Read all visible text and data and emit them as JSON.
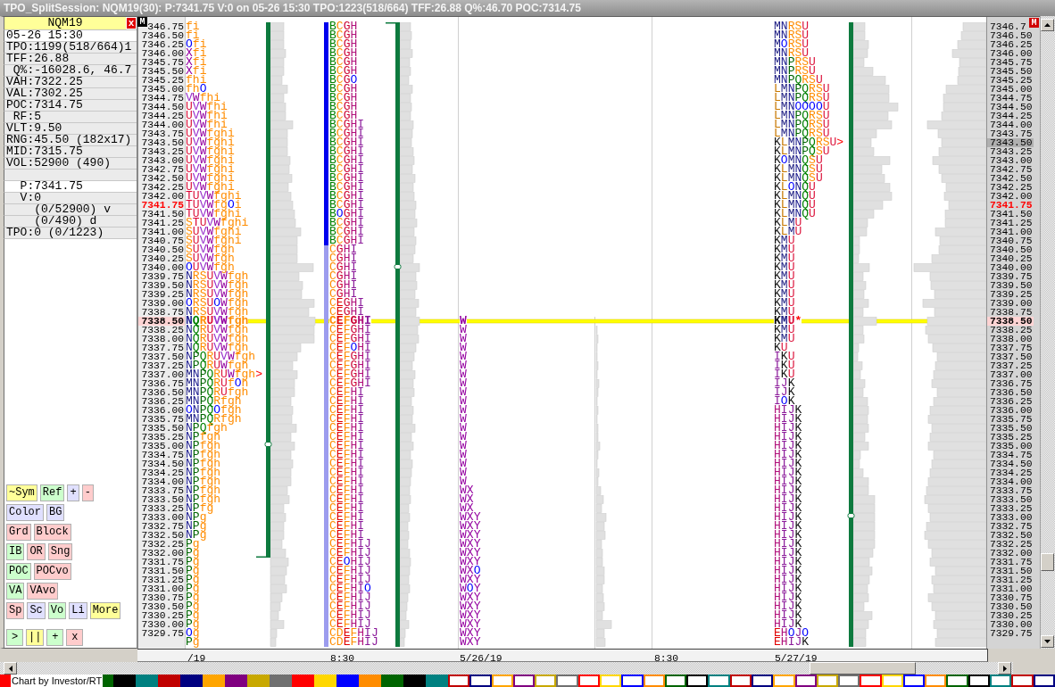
{
  "window": {
    "title": "TPO_SplitSession: NQM19(30): P:7341.75 V:0 on 05-26 15:30 TPO:1223(518/664) TFF:26.88 Q%:46.70 POC:7314.75"
  },
  "info_panel": {
    "symbol": "NQM19",
    "close": "x",
    "lines": [
      {
        "text": "05-26 15:30",
        "kind": "highlight"
      },
      {
        "text": "TPO:1199(518/664)1",
        "kind": "plain"
      },
      {
        "text": "TFF:26.88",
        "kind": "plain"
      },
      {
        "text": " Q%:-16028.6, 46.7",
        "kind": "plain"
      },
      {
        "text": "VAH:7322.25",
        "kind": "plain"
      },
      {
        "text": "VAL:7302.25",
        "kind": "plain"
      },
      {
        "text": "POC:7314.75",
        "kind": "plain"
      },
      {
        "text": " RF:5",
        "kind": "plain"
      },
      {
        "text": "VLT:9.50",
        "kind": "plain"
      },
      {
        "text": "RNG:45.50 (182x17)",
        "kind": "plain"
      },
      {
        "text": "MID:7315.75",
        "kind": "plain"
      },
      {
        "text": "VOL:52900 (490)",
        "kind": "plain"
      },
      {
        "kind": "plain"
      },
      {
        "text": "  P:7341.75",
        "kind": "highlight"
      },
      {
        "text": "  V:0",
        "kind": "plain"
      },
      {
        "text": "    (0/52900) v",
        "kind": "plain"
      },
      {
        "text": "    (0/490) d",
        "kind": "plain"
      },
      {
        "text": "TPO:0 (0/1223)",
        "kind": "plain"
      }
    ]
  },
  "button_rows": [
    {
      "buttons": [
        {
          "label": "~Sym",
          "color": "#ffff99"
        },
        {
          "label": "Ref",
          "color": "#ccffcc"
        },
        {
          "label": "+",
          "color": "#e0e0ff"
        },
        {
          "label": "-",
          "color": "#ffcccc"
        }
      ]
    },
    {
      "buttons": [
        {
          "label": "Color",
          "color": "#e0e0ff"
        },
        {
          "label": "BG",
          "color": "#e0e0ff"
        }
      ]
    },
    {
      "buttons": [
        {
          "label": "Grd",
          "color": "#ffcccc"
        },
        {
          "label": "Block",
          "color": "#ffcccc"
        }
      ]
    },
    {
      "buttons": [
        {
          "label": "IB",
          "color": "#ccffcc"
        },
        {
          "label": "OR",
          "color": "#ffcccc"
        },
        {
          "label": "Sng",
          "color": "#ffcccc"
        }
      ]
    },
    {
      "buttons": [
        {
          "label": "POC",
          "color": "#ccffcc"
        },
        {
          "label": "POCvo",
          "color": "#ffcccc"
        }
      ]
    },
    {
      "buttons": [
        {
          "label": "VA",
          "color": "#ccffcc"
        },
        {
          "label": "VAvo",
          "color": "#ffcccc"
        }
      ]
    },
    {
      "buttons": [
        {
          "label": "Sp",
          "color": "#ffcccc"
        },
        {
          "label": "Sc",
          "color": "#e0e0ff"
        },
        {
          "label": "Vo",
          "color": "#ccffcc"
        },
        {
          "label": "Li",
          "color": "#e0e0ff"
        },
        {
          "label": "More",
          "color": "#ffff99"
        }
      ]
    }
  ],
  "transport_buttons": [
    {
      "label": ">",
      "color": "#ccffcc"
    },
    {
      "label": "||",
      "color": "#ffff99"
    },
    {
      "label": "+",
      "color": "#ccffcc"
    },
    {
      "label": "x",
      "color": "#ffcccc"
    }
  ],
  "chart": {
    "menu_left": "M",
    "menu_right": "M",
    "rows": [
      {
        "price": "346.75",
        "profile_1": "fi",
        "profile_2": "BCGH",
        "profile_4": "MNRSU",
        "scale_price": "7346.7",
        "kind": "plain"
      },
      {
        "price": "7346.50",
        "profile_1": "fi",
        "profile_2": "BCGH",
        "profile_4": "MNRSU",
        "scale_price": "7346.50",
        "kind": "plain"
      },
      {
        "price": "7346.25",
        "profile_1": "Ofi",
        "profile_2": "BCGH",
        "profile_4": "MORSU",
        "scale_price": "7346.25",
        "kind": "plain"
      },
      {
        "price": "7346.00",
        "profile_1": "Xfi",
        "profile_2": "BCGH",
        "profile_4": "MNRSU",
        "scale_price": "7346.00",
        "kind": "plain"
      },
      {
        "price": "7345.75",
        "profile_1": "Xfi",
        "profile_2": "BCGH",
        "profile_4": "MNPRSU",
        "scale_price": "7345.75",
        "kind": "plain"
      },
      {
        "price": "7345.50",
        "profile_1": "Xfi",
        "profile_2": "BCGH",
        "profile_4": "MNPRSU",
        "scale_price": "7345.50",
        "kind": "plain"
      },
      {
        "price": "7345.25",
        "profile_1": "fhi",
        "profile_2": "BCGO",
        "profile_4": "MNPQRSU",
        "scale_price": "7345.25",
        "kind": "plain"
      },
      {
        "price": "7345.00",
        "profile_1": "fhO",
        "profile_2": "BCGH",
        "profile_4": "LMNPQRSU",
        "scale_price": "7345.00",
        "kind": "plain"
      },
      {
        "price": "7344.75",
        "profile_1": "VWfhi",
        "profile_2": "BCGH",
        "profile_4": "LMNPQRSU",
        "scale_price": "7344.75",
        "kind": "plain"
      },
      {
        "price": "7344.50",
        "profile_1": "UVWfhi",
        "profile_2": "BCGH",
        "profile_4": "LMNOOOOU",
        "scale_price": "7344.50",
        "kind": "plain"
      },
      {
        "price": "7344.25",
        "profile_1": "UVWfhi",
        "profile_2": "BCGH",
        "profile_4": "LMNPQRSU",
        "scale_price": "7344.25",
        "kind": "plain"
      },
      {
        "price": "7344.00",
        "profile_1": "UVWfhi",
        "profile_2": "BCGHI",
        "profile_4": "LMNPQRSU",
        "scale_price": "7344.00",
        "kind": "plain"
      },
      {
        "price": "7343.75",
        "profile_1": "UVWfghi",
        "profile_2": "BCGHI",
        "profile_4": "LMNPQRSU",
        "scale_price": "7343.75",
        "kind": "plain"
      },
      {
        "price": "7343.50",
        "profile_1": "UVWfghi",
        "profile_2": "BCGHI",
        "profile_4": "KLMNPQRSU>",
        "scale_price": "7343.50",
        "kind": "hover"
      },
      {
        "price": "7343.25",
        "profile_1": "UVWfghi",
        "profile_2": "BCGHI",
        "profile_4": "KLMNPQSU",
        "scale_price": "7343.25",
        "kind": "plain"
      },
      {
        "price": "7343.00",
        "profile_1": "UVWfghi",
        "profile_2": "BCGHI",
        "profile_4": "KOMNQSU",
        "scale_price": "7343.00",
        "kind": "plain"
      },
      {
        "price": "7342.75",
        "profile_1": "UVWfghi",
        "profile_2": "BCGHI",
        "profile_4": "KLMNQSU",
        "scale_price": "7342.75",
        "kind": "plain"
      },
      {
        "price": "7342.50",
        "profile_1": "UVWfghi",
        "profile_2": "BCGHI",
        "profile_4": "KLMNQSU",
        "scale_price": "7342.50",
        "kind": "plain"
      },
      {
        "price": "7342.25",
        "profile_1": "UVWfghi",
        "profile_2": "BCGHI",
        "profile_4": "KLONQU",
        "scale_price": "7342.25",
        "kind": "plain"
      },
      {
        "price": "7342.00",
        "profile_1": "TUVWfghi",
        "profile_2": "BCGHI",
        "profile_4": "KLMNQU",
        "scale_price": "7342.00",
        "kind": "plain"
      },
      {
        "price": "7341.75",
        "profile_1": "TUVWfgOi",
        "profile_2": "BCGHI",
        "profile_4": "KLMNQU",
        "scale_price": "7341.75",
        "kind": "last"
      },
      {
        "price": "7341.50",
        "profile_1": "TUVWfghi",
        "profile_2": "BOGHI",
        "profile_4": "KLMNQU",
        "scale_price": "7341.50",
        "kind": "plain"
      },
      {
        "price": "7341.25",
        "profile_1": "STUVWfghi",
        "profile_2": "BCGHI",
        "profile_4": "KLMU",
        "scale_price": "7341.25",
        "kind": "plain"
      },
      {
        "price": "7341.00",
        "profile_1": "SUVWfghi",
        "profile_2": "BCGHI",
        "profile_4": "KLMU",
        "scale_price": "7341.00",
        "kind": "plain"
      },
      {
        "price": "7340.75",
        "profile_1": "SUVWfghi",
        "profile_2": "BCGHI",
        "profile_4": "KMU",
        "scale_price": "7340.75",
        "kind": "plain"
      },
      {
        "price": "7340.50",
        "profile_1": "SUVWfgh",
        "profile_2": "CGHI",
        "profile_4": "KMU",
        "scale_price": "7340.50",
        "kind": "plain"
      },
      {
        "price": "7340.25",
        "profile_1": "SUVWfgh",
        "profile_2": "CGHI",
        "profile_4": "KMU",
        "scale_price": "7340.25",
        "kind": "plain"
      },
      {
        "price": "7340.00",
        "profile_1": "OUVWfgh",
        "profile_2": "CGHI",
        "profile_4": "KMU",
        "scale_price": "7340.00",
        "kind": "plain"
      },
      {
        "price": "7339.75",
        "profile_1": "NRSUVWfgh",
        "profile_2": "CGHI",
        "profile_4": "KMU",
        "scale_price": "7339.75",
        "kind": "plain"
      },
      {
        "price": "7339.50",
        "profile_1": "NRSUVWfgh",
        "profile_2": "CGHI",
        "profile_4": "KMU",
        "scale_price": "7339.50",
        "kind": "plain"
      },
      {
        "price": "7339.25",
        "profile_1": "NRSUVWfgh",
        "profile_2": "CGHI",
        "profile_4": "KMU",
        "scale_price": "7339.25",
        "kind": "plain"
      },
      {
        "price": "7339.00",
        "profile_1": "ORSUOWfgh",
        "profile_2": "CEGHI",
        "profile_4": "KMU",
        "scale_price": "7339.00",
        "kind": "plain"
      },
      {
        "price": "7338.75",
        "profile_1": "NRSUVWfgh",
        "profile_2": "CEGHI",
        "profile_4": "KMU",
        "scale_price": "7338.75",
        "kind": "plain"
      },
      {
        "price": "7338.50",
        "profile_1": "NQRUVWfgh",
        "profile_2": "CEFGHI",
        "profile_3": "W",
        "profile_4": "KMU*",
        "scale_price": "7338.50",
        "kind": "reference"
      },
      {
        "price": "7338.25",
        "profile_1": "NQRUVWfgh",
        "profile_2": "CEFGHI",
        "profile_3": "W",
        "profile_4": "KMU",
        "scale_price": "7338.25",
        "kind": "plain"
      },
      {
        "price": "7338.00",
        "profile_1": "NQRUVWfgh",
        "profile_2": "CEFGHI",
        "profile_3": "W",
        "profile_4": "KMU",
        "scale_price": "7338.00",
        "kind": "plain"
      },
      {
        "price": "7337.75",
        "profile_1": "NQRUVWfgh",
        "profile_2": "CEFOHI",
        "profile_3": "W",
        "profile_4": "KU",
        "scale_price": "7337.75",
        "kind": "plain"
      },
      {
        "price": "7337.50",
        "profile_1": "NPQRUVWfgh",
        "profile_2": "CEFGHI",
        "profile_3": "W",
        "profile_4": "IKU",
        "scale_price": "7337.50",
        "kind": "plain"
      },
      {
        "price": "7337.25",
        "profile_1": "NPQRUWfgh",
        "profile_2": "CEFGHI",
        "profile_3": "W",
        "profile_4": "IKU",
        "scale_price": "7337.25",
        "kind": "plain"
      },
      {
        "price": "7337.00",
        "profile_1": "MNPQRUWfgh>",
        "profile_2": "CEFGHI",
        "profile_3": "W",
        "profile_4": "IKU",
        "scale_price": "7337.00",
        "kind": "plain"
      },
      {
        "price": "7336.75",
        "profile_1": "MNPQRUfOh",
        "profile_2": "CEFGHI",
        "profile_3": "W",
        "profile_4": "IJK",
        "scale_price": "7336.75",
        "kind": "plain"
      },
      {
        "price": "7336.50",
        "profile_1": "MNPQRUfgh",
        "profile_2": "CEFHI",
        "profile_3": "W",
        "profile_4": "IJK",
        "scale_price": "7336.50",
        "kind": "plain"
      },
      {
        "price": "7336.25",
        "profile_1": "MNPQRfgh",
        "profile_2": "CEFHI",
        "profile_3": "W",
        "profile_4": "IOK",
        "scale_price": "7336.25",
        "kind": "plain"
      },
      {
        "price": "7336.00",
        "profile_1": "ONPQOfgh",
        "profile_2": "CEFHI",
        "profile_3": "W",
        "profile_4": "HIJK",
        "scale_price": "7336.00",
        "kind": "plain"
      },
      {
        "price": "7335.75",
        "profile_1": "MNPQRfgh",
        "profile_2": "CEFHI",
        "profile_3": "W",
        "profile_4": "HIJK",
        "scale_price": "7335.75",
        "kind": "plain"
      },
      {
        "price": "7335.50",
        "profile_1": "NPQfgh",
        "profile_2": "CEFHI",
        "profile_3": "W",
        "profile_4": "HIJK",
        "scale_price": "7335.50",
        "kind": "plain"
      },
      {
        "price": "7335.25",
        "profile_1": "NPfgh",
        "profile_2": "CEFHI",
        "profile_3": "W",
        "profile_4": "HIJK",
        "scale_price": "7335.25",
        "kind": "plain"
      },
      {
        "price": "7335.00",
        "profile_1": "NPfgh",
        "profile_2": "CEFHI",
        "profile_3": "W",
        "profile_4": "HIJK",
        "scale_price": "7335.00",
        "kind": "plain"
      },
      {
        "price": "7334.75",
        "profile_1": "NPfgh",
        "profile_2": "CEFHI",
        "profile_3": "W",
        "profile_4": "HIJK",
        "scale_price": "7334.75",
        "kind": "plain"
      },
      {
        "price": "7334.50",
        "profile_1": "NPfgh",
        "profile_2": "CEFHI",
        "profile_3": "W",
        "profile_4": "HIJK",
        "scale_price": "7334.50",
        "kind": "plain"
      },
      {
        "price": "7334.25",
        "profile_1": "NPfgh",
        "profile_2": "CEFHI",
        "profile_3": "W",
        "profile_4": "HIJK",
        "scale_price": "7334.25",
        "kind": "plain"
      },
      {
        "price": "7334.00",
        "profile_1": "NPfgh",
        "profile_2": "CEFHI",
        "profile_3": "W",
        "profile_4": "HIJK",
        "scale_price": "7334.00",
        "kind": "plain"
      },
      {
        "price": "7333.75",
        "profile_1": "NPfgh",
        "profile_2": "CEFHI",
        "profile_3": "WX",
        "profile_4": "HIJK",
        "scale_price": "7333.75",
        "kind": "plain"
      },
      {
        "price": "7333.50",
        "profile_1": "NPfgh",
        "profile_2": "CEFHI",
        "profile_3": "WX",
        "profile_4": "HIJK",
        "scale_price": "7333.50",
        "kind": "plain"
      },
      {
        "price": "7333.25",
        "profile_1": "NPfg",
        "profile_2": "CEFHI",
        "profile_3": "WX",
        "profile_4": "HIJK",
        "scale_price": "7333.25",
        "kind": "plain"
      },
      {
        "price": "7333.00",
        "profile_1": "NPg",
        "profile_2": "CEFHI",
        "profile_3": "WXY",
        "profile_4": "HIJK",
        "scale_price": "7333.00",
        "kind": "plain"
      },
      {
        "price": "7332.75",
        "profile_1": "NPg",
        "profile_2": "CEFHI",
        "profile_3": "WXY",
        "profile_4": "HIJK",
        "scale_price": "7332.75",
        "kind": "plain"
      },
      {
        "price": "7332.50",
        "profile_1": "NPg",
        "profile_2": "CEFHI",
        "profile_3": "WXY",
        "profile_4": "HIJK",
        "scale_price": "7332.50",
        "kind": "plain"
      },
      {
        "price": "7332.25",
        "profile_1": "Pg",
        "profile_2": "CEFHIJ",
        "profile_3": "WXY",
        "profile_4": "HIJK",
        "scale_price": "7332.25",
        "kind": "plain"
      },
      {
        "price": "7332.00",
        "profile_1": "Pg",
        "profile_2": "CEFHIJ",
        "profile_3": "WXY",
        "profile_4": "HIJK",
        "scale_price": "7332.00",
        "kind": "plain"
      },
      {
        "price": "7331.75",
        "profile_1": "Pg",
        "profile_2": "CEOHIJ",
        "profile_3": "WXY",
        "profile_4": "HIJK",
        "scale_price": "7331.75",
        "kind": "plain"
      },
      {
        "price": "7331.50",
        "profile_1": "Pg",
        "profile_2": "CEFHIJ",
        "profile_3": "WXO",
        "profile_4": "HIJK",
        "scale_price": "7331.50",
        "kind": "plain"
      },
      {
        "price": "7331.25",
        "profile_1": "Pg",
        "profile_2": "CEFHIJ",
        "profile_3": "WXY",
        "profile_4": "HIJK",
        "scale_price": "7331.25",
        "kind": "plain"
      },
      {
        "price": "7331.00",
        "profile_1": "Pg",
        "profile_2": "CEFHIO",
        "profile_3": "WOY",
        "profile_4": "HIJK",
        "scale_price": "7331.00",
        "kind": "plain"
      },
      {
        "price": "7330.75",
        "profile_1": "Pg",
        "profile_2": "CEFHIJ",
        "profile_3": "WXY",
        "profile_4": "HIJK",
        "scale_price": "7330.75",
        "kind": "plain"
      },
      {
        "price": "7330.50",
        "profile_1": "Pg",
        "profile_2": "CEFHIJ",
        "profile_3": "WXY",
        "profile_4": "HIJK",
        "scale_price": "7330.50",
        "kind": "plain"
      },
      {
        "price": "7330.25",
        "profile_1": "Pg",
        "profile_2": "CEFHIJ",
        "profile_3": "WXY",
        "profile_4": "HIJK",
        "scale_price": "7330.25",
        "kind": "plain"
      },
      {
        "price": "7330.00",
        "profile_1": "Pg",
        "profile_2": "CEFHIJ",
        "profile_3": "WXY",
        "profile_4": "HIJK",
        "scale_price": "7330.00",
        "kind": "plain"
      },
      {
        "price": "7329.75",
        "profile_1": "Og",
        "profile_2": "CDEFHIJ",
        "profile_3": "WXY",
        "profile_4": "EHOJO",
        "scale_price": "7329.75",
        "kind": "plain"
      },
      {
        "profile_1": "Pg",
        "profile_2": "CDEFHIJ",
        "profile_3": "WXY",
        "profile_4": "EHIJK",
        "kind": "plain"
      }
    ],
    "time_axis": [
      "/19",
      "8:30",
      "5/26/19",
      "8:30",
      "5/27/19"
    ]
  },
  "footer": {
    "credit": "Chart by Investor/RT"
  },
  "palette": [
    {
      "color": "#ff0000",
      "filled": true
    },
    {
      "color": "#006400",
      "filled": true
    },
    {
      "color": "#000000",
      "filled": true
    },
    {
      "color": "#008080",
      "filled": true
    },
    {
      "color": "#c00000",
      "filled": true
    },
    {
      "color": "#000080",
      "filled": true
    },
    {
      "color": "#ffa500",
      "filled": true
    },
    {
      "color": "#800080",
      "filled": true
    },
    {
      "color": "#c8a800",
      "filled": true
    },
    {
      "color": "#707070",
      "filled": true
    },
    {
      "color": "#ff0000",
      "filled": true
    },
    {
      "color": "#ffd700",
      "filled": true
    },
    {
      "color": "#0000ff",
      "filled": true
    },
    {
      "color": "#ff8c00",
      "filled": true
    },
    {
      "color": "#006400",
      "filled": true
    },
    {
      "color": "#000000",
      "filled": true
    },
    {
      "color": "#008080",
      "filled": true
    },
    {
      "color": "#c00000",
      "filled": false
    },
    {
      "color": "#000080",
      "filled": false
    },
    {
      "color": "#ffa500",
      "filled": false
    },
    {
      "color": "#800080",
      "filled": false
    },
    {
      "color": "#c8a800",
      "filled": false
    },
    {
      "color": "#707070",
      "filled": false
    },
    {
      "color": "#ff0000",
      "filled": false
    },
    {
      "color": "#ffd700",
      "filled": false
    },
    {
      "color": "#0000ff",
      "filled": false
    },
    {
      "color": "#ff8c00",
      "filled": false
    },
    {
      "color": "#006400",
      "filled": false
    },
    {
      "color": "#000000",
      "filled": false
    },
    {
      "color": "#008080",
      "filled": false
    },
    {
      "color": "#c00000",
      "filled": false
    },
    {
      "color": "#000080",
      "filled": false
    },
    {
      "color": "#ffa500",
      "filled": false
    },
    {
      "color": "#800080",
      "filled": false
    },
    {
      "color": "#c8a800",
      "filled": false
    },
    {
      "color": "#707070",
      "filled": false
    },
    {
      "color": "#ff0000",
      "filled": false
    },
    {
      "color": "#ffd700",
      "filled": false
    },
    {
      "color": "#0000ff",
      "filled": false
    },
    {
      "color": "#ff8c00",
      "filled": false
    },
    {
      "color": "#006400",
      "filled": false
    },
    {
      "color": "#000000",
      "filled": false
    },
    {
      "color": "#008080",
      "filled": false
    },
    {
      "color": "#c00000",
      "filled": false
    },
    {
      "color": "#000080",
      "filled": false
    }
  ]
}
